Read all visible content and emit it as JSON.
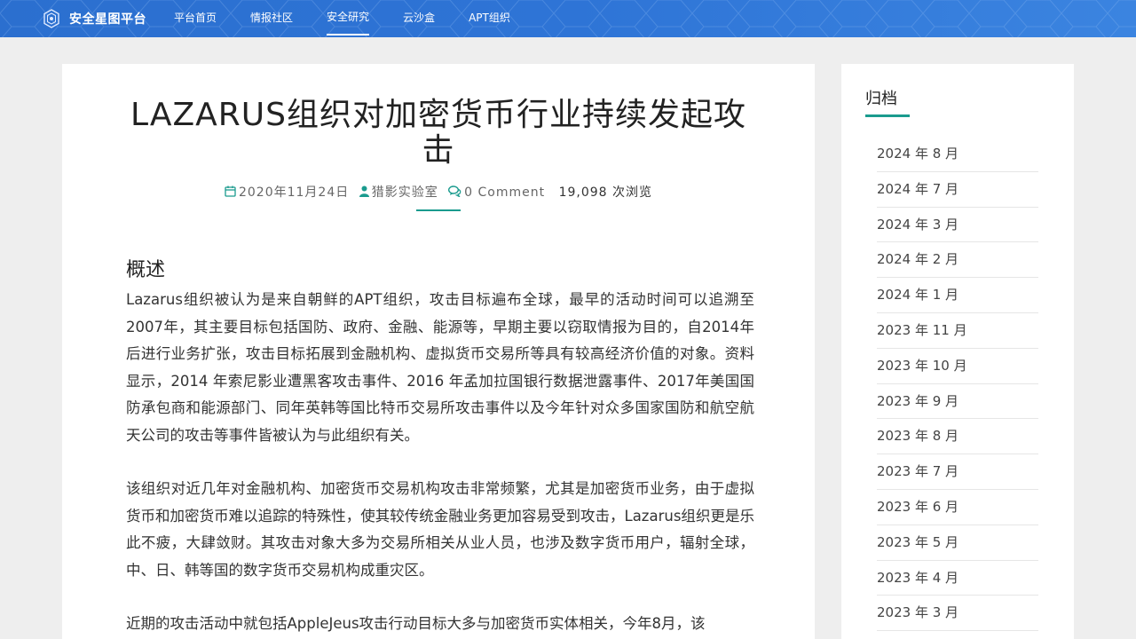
{
  "brand": {
    "name": "安全星图平台",
    "logo_icon": "shield-logo-icon"
  },
  "nav": {
    "items": [
      {
        "label": "平台首页",
        "active": false
      },
      {
        "label": "情报社区",
        "active": false
      },
      {
        "label": "安全研究",
        "active": true
      },
      {
        "label": "云沙盒",
        "active": false
      },
      {
        "label": "APT组织",
        "active": false
      }
    ]
  },
  "article": {
    "title": "LAZARUS组织对加密货币行业持续发起攻击",
    "meta": {
      "date": "2020年11月24日",
      "author": "猎影实验室",
      "comments": "0 Comment",
      "views": "19,098 次浏览"
    },
    "section_heading": "概述",
    "paragraphs": [
      "Lazarus组织被认为是来自朝鲜的APT组织，攻击目标遍布全球，最早的活动时间可以追溯至2007年，其主要目标包括国防、政府、金融、能源等，早期主要以窃取情报为目的，自2014年后进行业务扩张，攻击目标拓展到金融机构、虚拟货币交易所等具有较高经济价值的对象。资料显示，2014 年索尼影业遭黑客攻击事件、2016 年孟加拉国银行数据泄露事件、2017年美国国防承包商和能源部门、同年英韩等国比特币交易所攻击事件以及今年针对众多国家国防和航空航天公司的攻击等事件皆被认为与此组织有关。",
      "该组织对近几年对金融机构、加密货币交易机构攻击非常频繁，尤其是加密货币业务，由于虚拟货币和加密货币难以追踪的特殊性，使其较传统金融业务更加容易受到攻击，Lazarus组织更是乐此不疲，大肆敛财。其攻击对象大多为交易所相关从业人员，也涉及数字货币用户，辐射全球，中、日、韩等国的数字货币交易机构成重灾区。",
      "近期的攻击活动中就包括AppleJeus攻击行动目标大多与加密货币实体相关，今年8月，该"
    ]
  },
  "sidebar": {
    "title": "归档",
    "archives": [
      "2024 年 8 月",
      "2024 年 7 月",
      "2024 年 3 月",
      "2024 年 2 月",
      "2024 年 1 月",
      "2023 年 11 月",
      "2023 年 10 月",
      "2023 年 9 月",
      "2023 年 8 月",
      "2023 年 7 月",
      "2023 年 6 月",
      "2023 年 5 月",
      "2023 年 4 月",
      "2023 年 3 月"
    ]
  },
  "colors": {
    "header_blue": "#2e74d6",
    "accent_teal": "#1a9b8e",
    "page_bg": "#eeeeee"
  }
}
